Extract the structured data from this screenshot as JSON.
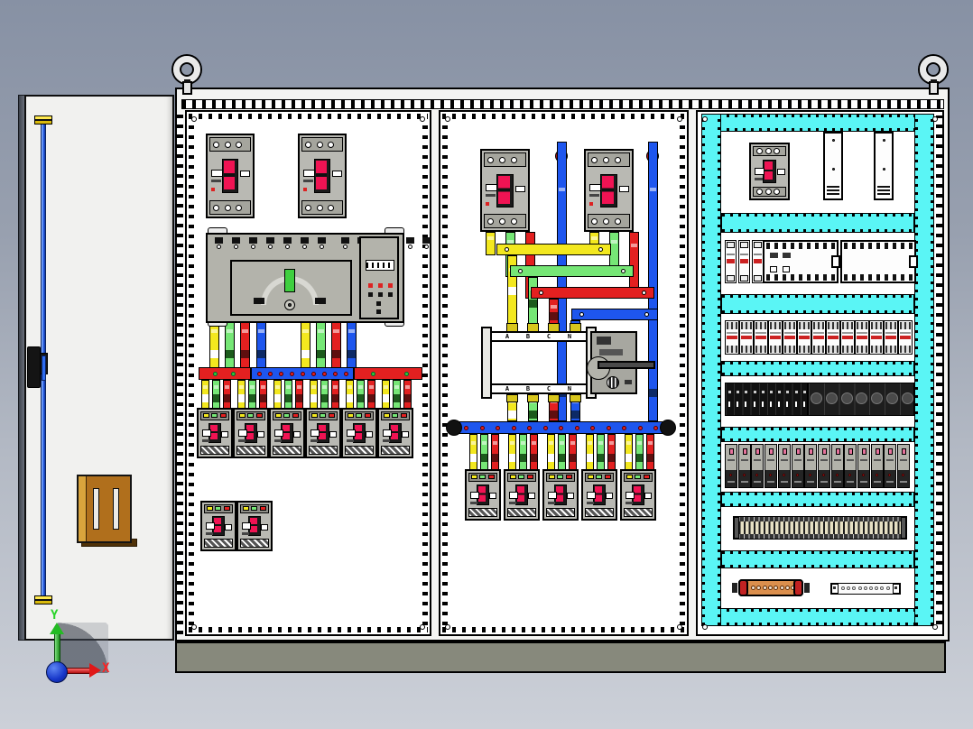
{
  "view": {
    "type": "3d-cad-model-front-view",
    "subject": "low-voltage power distribution switchgear cabinet with open door",
    "axis_triad": {
      "x_label": "X",
      "y_label": "Y"
    }
  },
  "palette": {
    "background_top": "#8791a4",
    "background_bottom": "#ccd0d8",
    "cabinet_body": "#f4f4f2",
    "panel_plate": "#ffffff",
    "plinth_gray": "#87897c",
    "wire_duct_cyan": "#5af5f5",
    "door_white": "#f1f1ef",
    "phase_l1_yellow": "#f3e81f",
    "phase_l2_green": "#76e776",
    "phase_l3_red": "#e32020",
    "neutral_blue": "#1e56ee",
    "breaker_handle_red": "#f01353",
    "copper_busbar": "#db8f4d",
    "door_lock_rod_blue": "#2e6cf0",
    "hinge_box_brown": "#b06f1c"
  },
  "door": {
    "lock_rod_count": 1,
    "handle_count": 1,
    "hinge_box_count": 1
  },
  "lifting_eyebolts": 2,
  "sections": {
    "left_panel": {
      "incoming_mccb_count": 2,
      "ats": {
        "type": "dual-power-automatic-transfer-switch",
        "dial_pointer_color": "#3fcf3f",
        "indicator_module": true
      },
      "busbar": {
        "segments": [
          "red",
          "blue",
          "red"
        ],
        "red_segment_green_dots": 4,
        "blue_segment_red_dots": 9,
        "phase_drop_colors": [
          "yellow",
          "green",
          "red",
          "blue"
        ]
      },
      "feeder_mccb_count": 6,
      "feeder_drop_colors": [
        "yellow",
        "green",
        "red"
      ],
      "spare_mccb_count": 2
    },
    "middle_panel": {
      "incoming_mccb_count": 2,
      "neutral_riser_count": 2,
      "phase_crossover_bars": [
        "yellow",
        "green",
        "red",
        "blue"
      ],
      "busbar_support": {
        "phase_labels": [
          "A",
          "B",
          "C",
          "N"
        ]
      },
      "changeover_switch": {
        "handle": true
      },
      "neutral_busbar_dot_count": 13,
      "distribution_mccb_count": 5,
      "feeder_drop_colors": [
        "yellow",
        "green",
        "red"
      ]
    },
    "right_panel": {
      "row1": {
        "mccb_count": 1,
        "cover_strip_count": 2
      },
      "row2": {
        "mcb_count": 3,
        "plc_module_count": 2
      },
      "row3": {
        "mcb_count": 13
      },
      "row4": {
        "mini_relay_count": 10,
        "contactor_count": 7
      },
      "row5": {
        "relay_module_count": 14
      },
      "row6": {
        "terminal_strip_count": 1
      },
      "row7": {
        "copper_earth_bar_holes": 8,
        "neutral_terminal_bar_holes": 9
      }
    }
  }
}
